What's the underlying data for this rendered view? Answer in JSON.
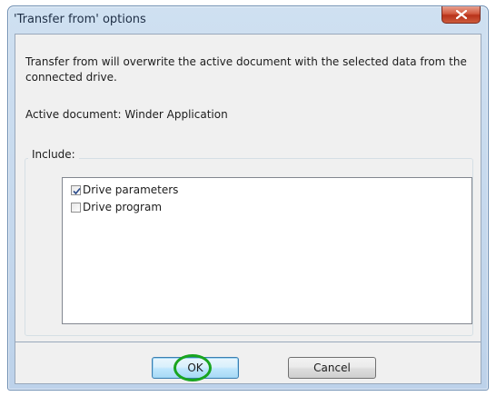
{
  "window": {
    "title": "'Transfer from' options"
  },
  "message": {
    "text": "Transfer from will overwrite the active document with the selected data from the connected drive.",
    "active_document": "Active document: Winder Application"
  },
  "include": {
    "label": "Include:",
    "items": [
      {
        "label": "Drive parameters",
        "checked": true
      },
      {
        "label": "Drive program",
        "checked": false
      }
    ]
  },
  "buttons": {
    "ok_label": "OK",
    "cancel_label": "Cancel"
  },
  "colors": {
    "highlight_ring": "#19a51f",
    "close_button": "#c7472b"
  },
  "icons": {
    "close": "close-icon",
    "check": "checkmark-icon"
  }
}
